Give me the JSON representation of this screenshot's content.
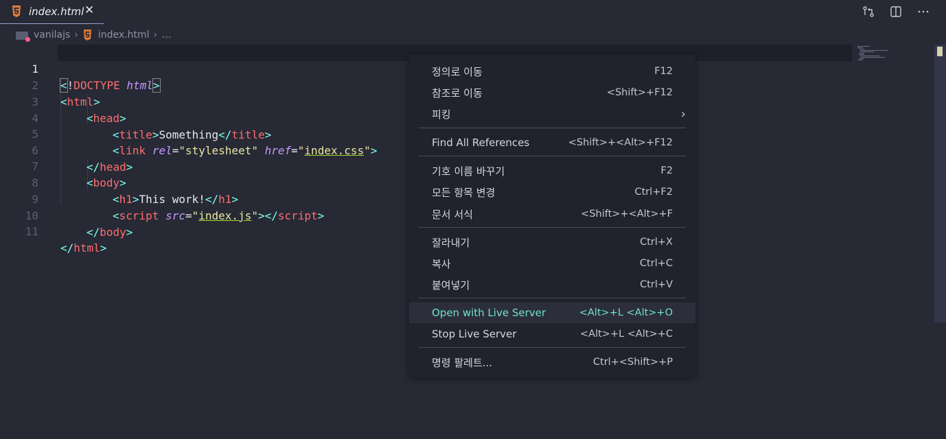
{
  "tab": {
    "filename": "index.html",
    "close": "✕"
  },
  "actions": [
    "source-control-icon",
    "split-editor-icon",
    "more-actions-icon"
  ],
  "breadcrumb": {
    "folder": "vanilajs",
    "file": "index.html",
    "more": "..."
  },
  "editor": {
    "line_numbers": [
      "1",
      "2",
      "3",
      "4",
      "5",
      "6",
      "7",
      "8",
      "9",
      "10",
      "11"
    ],
    "active_line": 1
  },
  "code": {
    "l1": {
      "lt": "<",
      "bang": "!",
      "doctype": "DOCTYPE",
      "sp": " ",
      "html": "html",
      "gt": ">"
    },
    "l2": {
      "lt": "<",
      "tag": "html",
      "gt": ">"
    },
    "l3": {
      "lt": "<",
      "tag": "head",
      "gt": ">"
    },
    "l4": {
      "lt": "<",
      "tag": "title",
      "gt": ">",
      "text": "Something",
      "lt2": "</",
      "tag2": "title",
      "gt2": ">"
    },
    "l5": {
      "lt": "<",
      "tag": "link",
      "sp": " ",
      "attr1": "rel",
      "eq1": "=",
      "q1": "\"",
      "val1": "stylesheet",
      "q2": "\"",
      "sp2": " ",
      "attr2": "href",
      "eq2": "=",
      "q3": "\"",
      "val2": "index.css",
      "q4": "\"",
      "gt": ">"
    },
    "l6": {
      "lt": "</",
      "tag": "head",
      "gt": ">"
    },
    "l7": {
      "lt": "<",
      "tag": "body",
      "gt": ">"
    },
    "l8": {
      "lt": "<",
      "tag": "h1",
      "gt": ">",
      "text": "This work!",
      "lt2": "</",
      "tag2": "h1",
      "gt2": ">"
    },
    "l9": {
      "lt": "<",
      "tag": "script",
      "sp": " ",
      "attr": "src",
      "eq": "=",
      "q1": "\"",
      "val": "index.js",
      "q2": "\"",
      "gt": ">",
      "lt2": "</",
      "tag2": "script",
      "gt2": ">"
    },
    "l10": {
      "lt": "</",
      "tag": "body",
      "gt": ">"
    },
    "l11": {
      "lt": "</",
      "tag": "html",
      "gt": ">"
    }
  },
  "context_menu": {
    "items": [
      {
        "label": "정의로 이동",
        "key": "F12"
      },
      {
        "label": "참조로 이동",
        "key": "<Shift>+F12"
      },
      {
        "label": "피킹",
        "key": "",
        "chevron": "›"
      },
      {
        "label": "Find All References",
        "key": "<Shift>+<Alt>+F12"
      },
      {
        "label": "기호 이름 바꾸기",
        "key": "F2"
      },
      {
        "label": "모든 항목 변경",
        "key": "Ctrl+F2"
      },
      {
        "label": "문서 서식",
        "key": "<Shift>+<Alt>+F"
      },
      {
        "label": "잘라내기",
        "key": "Ctrl+X"
      },
      {
        "label": "복사",
        "key": "Ctrl+C"
      },
      {
        "label": "붙여넣기",
        "key": "Ctrl+V"
      },
      {
        "label": "Open with Live Server",
        "key": "<Alt>+L <Alt>+O"
      },
      {
        "label": "Stop Live Server",
        "key": "<Alt>+L <Alt>+C"
      },
      {
        "label": "명령 팔레트...",
        "key": "Ctrl+<Shift>+P"
      }
    ],
    "highlighted_index": 10
  },
  "colors": {
    "background": "#272935",
    "menu_bg": "#21222c",
    "highlight_text": "#6fe3c6",
    "tag": "#ff6e6e",
    "bracket": "#80ffea",
    "attr": "#c49bff",
    "string": "#e8e8a0"
  }
}
